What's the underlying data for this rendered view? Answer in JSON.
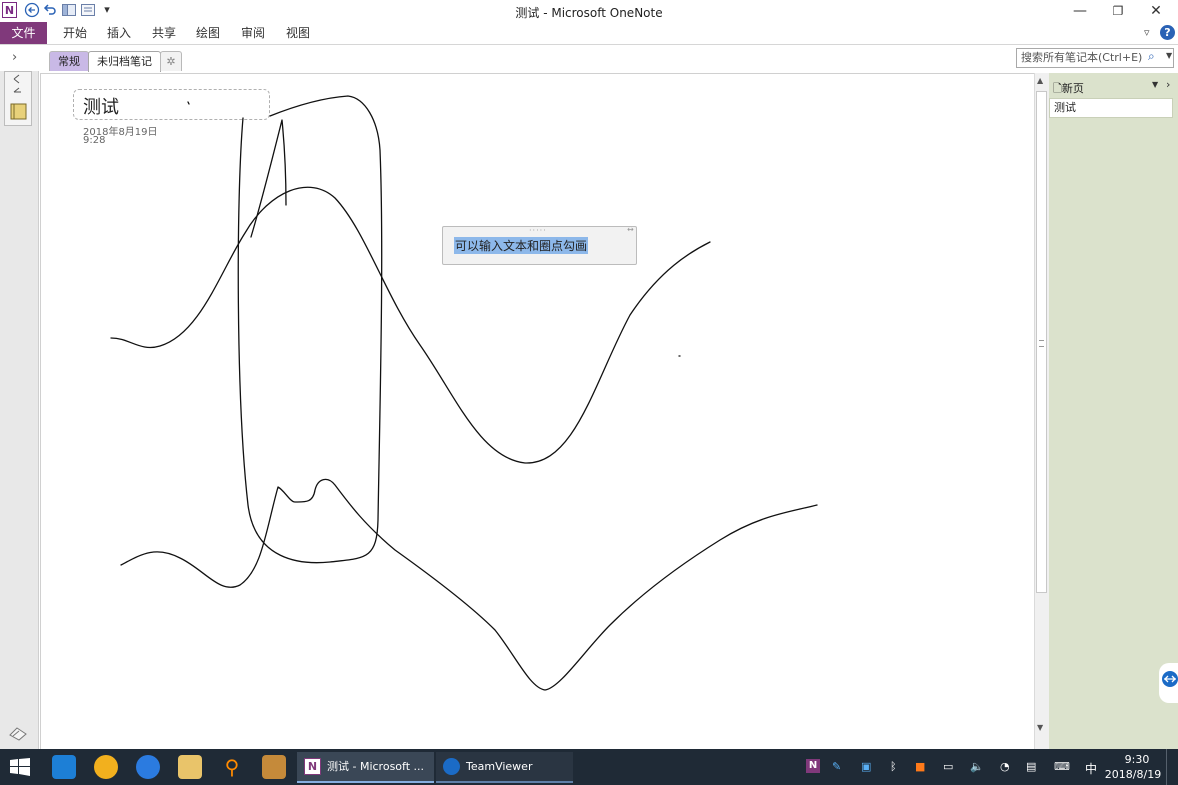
{
  "window": {
    "title": "测试  -  Microsoft OneNote",
    "app_logo": "N",
    "controls": {
      "minimize": "—",
      "restore": "❐",
      "close": "✕"
    }
  },
  "ribbon": {
    "file_tab": "文件",
    "tabs": [
      "开始",
      "插入",
      "共享",
      "绘图",
      "审阅",
      "视图"
    ],
    "help": "?"
  },
  "sections": {
    "tabs": [
      "常规",
      "未归档笔记"
    ],
    "active": "未归档笔记",
    "new_tab": "✲"
  },
  "search": {
    "placeholder": "搜索所有笔记本(Ctrl+E)"
  },
  "page": {
    "title": "测试",
    "date": "2018年8月19日",
    "time": "9:28",
    "note_text": "可以输入文本和圈点勾画"
  },
  "page_panel": {
    "new_page": "新页",
    "pages": [
      "测试"
    ]
  },
  "taskbar": {
    "windows": [
      "测试 - Microsoft ...",
      "TeamViewer"
    ],
    "ime": "中",
    "time": "9:30",
    "date": "2018/8/19"
  },
  "colors": {
    "onenote_purple": "#80397b",
    "section_general": "#c9b9e6",
    "page_panel_bg": "#dbe2cc",
    "taskbar_bg": "#1f2a36",
    "selection": "#8db8ea"
  },
  "icons": [
    "back-icon",
    "undo-icon",
    "dock-icon",
    "view-icon",
    "customize-dropdown-icon",
    "search-icon",
    "notebook-icon",
    "windows-start-icon"
  ]
}
